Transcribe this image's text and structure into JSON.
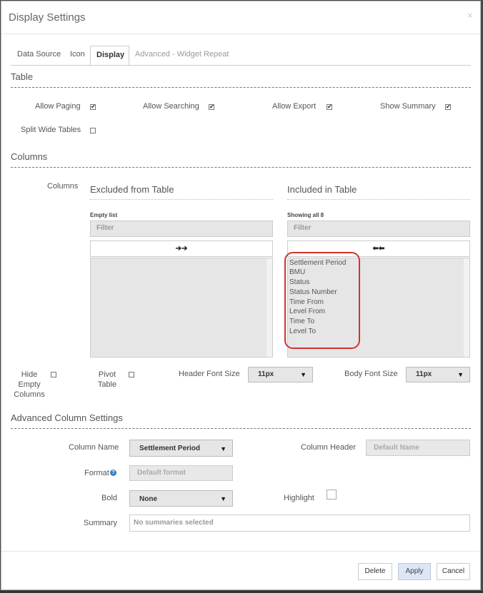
{
  "dialog": {
    "title": "Display Settings",
    "close_glyph": "×"
  },
  "tabs": [
    {
      "label": "Data Source",
      "active": false
    },
    {
      "label": "Icon",
      "active": false
    },
    {
      "label": "Display",
      "active": true
    },
    {
      "label": "Advanced - Widget Repeat",
      "active": false
    }
  ],
  "table_section": {
    "heading": "Table",
    "options": [
      {
        "label": "Allow Paging",
        "checked": true
      },
      {
        "label": "Allow Searching",
        "checked": true
      },
      {
        "label": "Allow Export",
        "checked": true
      },
      {
        "label": "Show Summary",
        "checked": true
      },
      {
        "label": "Split Wide Tables",
        "checked": false
      }
    ]
  },
  "columns_section": {
    "heading": "Columns",
    "field_label": "Columns",
    "excluded": {
      "heading": "Excluded from Table",
      "status": "Empty list",
      "filter_placeholder": "Filter",
      "move_glyph": "➔➔",
      "items": []
    },
    "included": {
      "heading": "Included in Table",
      "status": "Showing all 8",
      "filter_placeholder": "Filter",
      "move_glyph": "⬅⬅",
      "items": [
        "Settlement Period",
        "BMU",
        "Status",
        "Status Number",
        "Time From",
        "Level From",
        "Time To",
        "Level To"
      ]
    },
    "hide_empty": {
      "label_lines": [
        "Hide",
        "Empty",
        "Columns"
      ],
      "checked": false
    },
    "pivot": {
      "label_lines": [
        "Pivot",
        "Table"
      ],
      "checked": false
    },
    "header_font": {
      "label": "Header Font Size",
      "value": "11px"
    },
    "body_font": {
      "label": "Body Font Size",
      "value": "11px"
    }
  },
  "advanced": {
    "heading": "Advanced Column Settings",
    "column_name": {
      "label": "Column Name",
      "value": "Settlement Period"
    },
    "column_header": {
      "label": "Column Header",
      "placeholder": "Default Name"
    },
    "format": {
      "label": "Format",
      "placeholder": "Default format",
      "help_glyph": "?"
    },
    "bold": {
      "label": "Bold",
      "value": "None"
    },
    "highlight": {
      "label": "Highlight",
      "checked": false
    },
    "summary": {
      "label": "Summary",
      "value": "No summaries selected"
    }
  },
  "footer": {
    "delete": "Delete",
    "apply": "Apply",
    "cancel": "Cancel"
  },
  "caret_glyph": "▼",
  "check_glyph": "✔",
  "colors": {
    "highlight_ring": "#d0342c",
    "help_icon": "#3b7dc4",
    "apply_button": "#dde6f5"
  }
}
